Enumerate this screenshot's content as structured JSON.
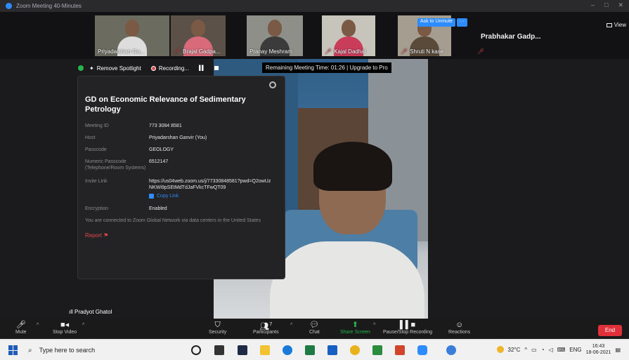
{
  "window": {
    "title": "Zoom Meeting 40-Minutes"
  },
  "gallery": {
    "tiles": [
      {
        "name": "Priyadarshan Ga...",
        "muted": false
      },
      {
        "name": "Brajal Gadpa...",
        "muted": true
      },
      {
        "name": "Pranay Meshram",
        "muted": false
      },
      {
        "name": "Kajal Dadhal",
        "muted": true
      },
      {
        "name": "Shruti N kase",
        "muted": true
      }
    ],
    "name_only": "Prabhakar Gadp...",
    "view_label": "View",
    "ask_unmute": "Ask to Unmute",
    "ask_unmute_more": "···"
  },
  "topbar": {
    "remove_spotlight": "Remove Spotlight",
    "recording": "Recording...",
    "remaining": "Remaining Meeting Time: 01:26 | Upgrade to Pro"
  },
  "info": {
    "title": "GD on Economic Relevance of Sedimentary Petrology",
    "rows": [
      {
        "key": "Meeting ID",
        "value": "773 3084 8581"
      },
      {
        "key": "Host",
        "value": "Priyadarshan Ganvir (You)"
      },
      {
        "key": "Passcode",
        "value": "GEOLOGY"
      },
      {
        "key": "Numeric Passcode (Telephone/Room Systems)",
        "value": "6512147"
      },
      {
        "key": "Invite Link",
        "value": "https://us04web.zoom.us/j/77330848581?pwd=Q2owUzNKWi9pSEtMdTdJaFVkcTFwQT09"
      }
    ],
    "copy_link": "Copy Link",
    "encryption_key": "Encryption",
    "encryption_value": "Enabled",
    "connected": "You are connected to Zoom Global Network via data centers in the United States",
    "report": "Report"
  },
  "self_name": "Pradyot Ghatol",
  "toolbar": {
    "mute": "Mute",
    "stop_video": "Stop Video",
    "security": "Security",
    "participants": "Participants",
    "participants_count": "7",
    "chat": "Chat",
    "share_screen": "Share Screen",
    "recording": "Pause/Stop Recording",
    "reactions": "Reactions",
    "end": "End"
  },
  "taskbar": {
    "search_placeholder": "Type here to search",
    "temperature": "32°C",
    "lang": "ENG",
    "time": "16:43",
    "date": "18-06-2021"
  },
  "colors": {
    "accent": "#2d8cff",
    "danger": "#e0313a",
    "green": "#25b54c"
  }
}
